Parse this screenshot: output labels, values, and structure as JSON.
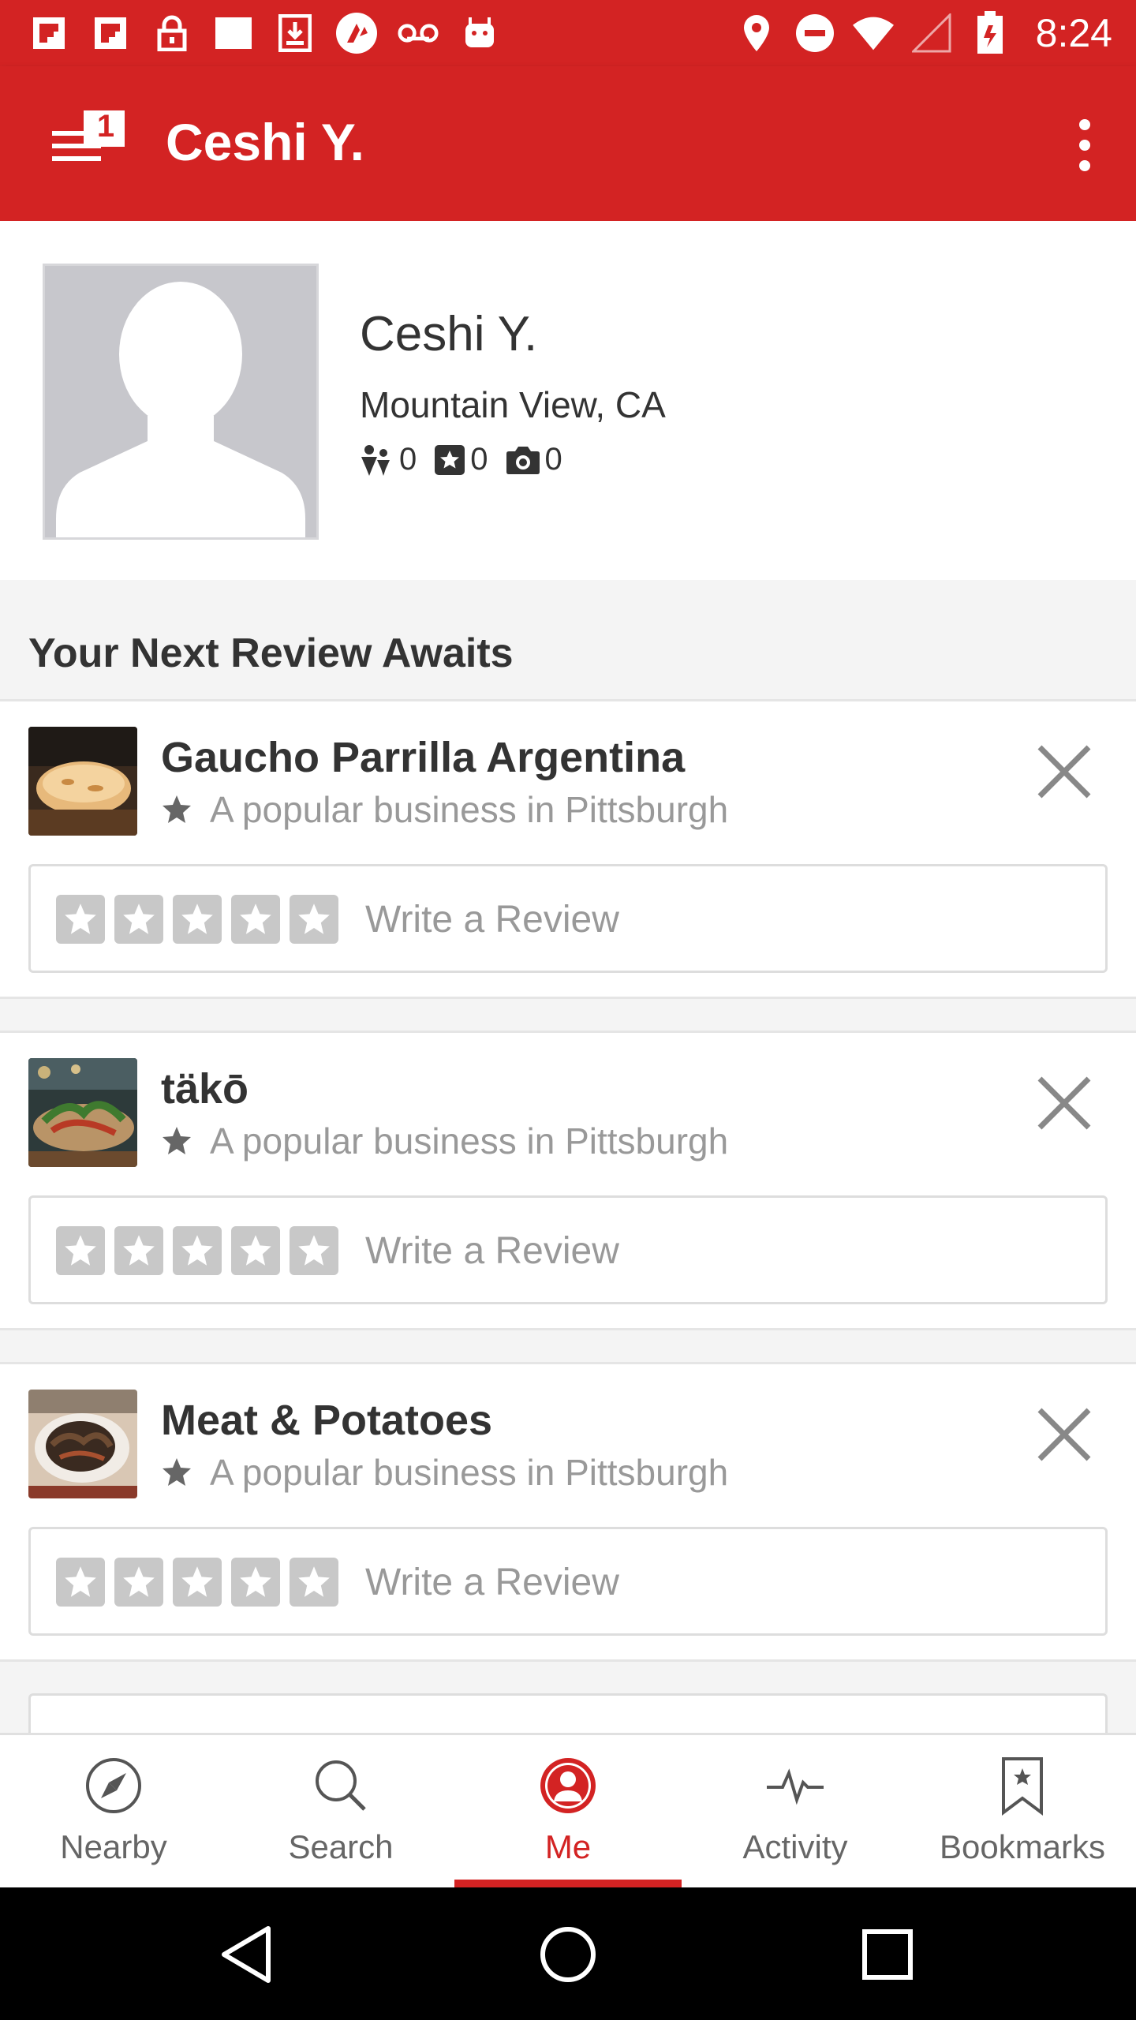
{
  "status_bar": {
    "time": "8:24",
    "left_icons": [
      "flipboard-icon",
      "flipboard-icon",
      "lock-icon",
      "square-icon",
      "download-icon",
      "android-wear-icon",
      "voicemail-icon",
      "android-icon"
    ],
    "right_icons": [
      "location-icon",
      "do-not-disturb-icon",
      "wifi-icon",
      "signal-icon",
      "battery-icon"
    ]
  },
  "toolbar": {
    "title": "Ceshi Y.",
    "notification_count": "1"
  },
  "profile": {
    "name": "Ceshi Y.",
    "location": "Mountain View, CA",
    "friends_count": "0",
    "reviews_count": "0",
    "photos_count": "0"
  },
  "section_title": "Your Next Review Awaits",
  "suggestions": [
    {
      "name": "Gaucho Parrilla Argentina",
      "subtitle": "A popular business in Pittsburgh",
      "review_prompt": "Write a Review"
    },
    {
      "name": "täkō",
      "subtitle": "A popular business in Pittsburgh",
      "review_prompt": "Write a Review"
    },
    {
      "name": "Meat & Potatoes",
      "subtitle": "A popular business in Pittsburgh",
      "review_prompt": "Write a Review"
    }
  ],
  "bottom_nav": {
    "active": "Me",
    "items": [
      {
        "label": "Nearby",
        "icon": "compass-icon"
      },
      {
        "label": "Search",
        "icon": "search-icon"
      },
      {
        "label": "Me",
        "icon": "profile-icon"
      },
      {
        "label": "Activity",
        "icon": "activity-icon"
      },
      {
        "label": "Bookmarks",
        "icon": "bookmark-icon"
      }
    ]
  },
  "colors": {
    "brand": "#d32323",
    "text": "#333333",
    "muted": "#999999"
  }
}
